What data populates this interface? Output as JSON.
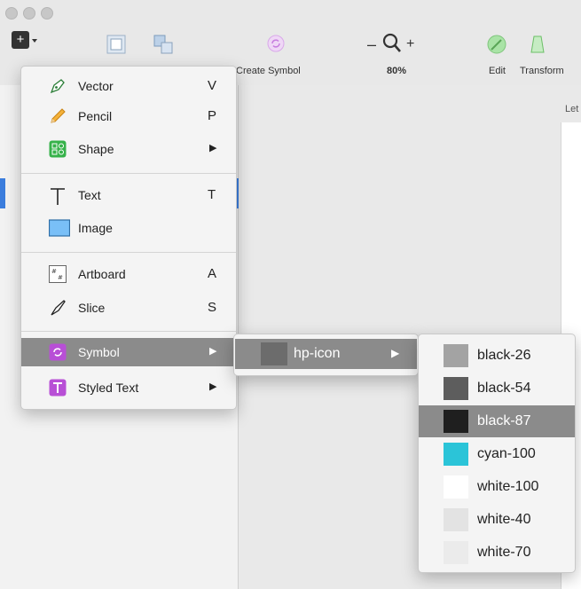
{
  "toolbar": {
    "insert_label": "+",
    "create_symbol_label": "Create Symbol",
    "zoom_minus": "–",
    "zoom_plus": "+",
    "zoom_level": "80%",
    "edit_label": "Edit",
    "transform_label": "Transform"
  },
  "canvas": {
    "artboard_label_partial": "Let"
  },
  "insert_menu": {
    "items": [
      {
        "label": "Vector",
        "shortcut": "V",
        "icon": "vector-pen-icon"
      },
      {
        "label": "Pencil",
        "shortcut": "P",
        "icon": "pencil-icon"
      },
      {
        "label": "Shape",
        "arrow": "▶",
        "icon": "shape-icon"
      },
      {
        "label": "Text",
        "shortcut": "T",
        "icon": "text-icon"
      },
      {
        "label": "Image",
        "icon": "image-icon"
      },
      {
        "label": "Artboard",
        "shortcut": "A",
        "icon": "artboard-icon"
      },
      {
        "label": "Slice",
        "shortcut": "S",
        "icon": "slice-knife-icon"
      },
      {
        "label": "Symbol",
        "arrow": "▶",
        "icon": "symbol-icon",
        "highlighted": true
      },
      {
        "label": "Styled Text",
        "arrow": "▶",
        "icon": "styled-text-icon"
      }
    ]
  },
  "symbol_submenu": {
    "label": "hp-icon",
    "arrow": "▶",
    "swatch_color": "#6c6c6c"
  },
  "color_submenu": {
    "items": [
      {
        "label": "black-26",
        "color": "#a3a3a3"
      },
      {
        "label": "black-54",
        "color": "#5d5d5d"
      },
      {
        "label": "black-87",
        "color": "#1f1f1f",
        "highlighted": true
      },
      {
        "label": "cyan-100",
        "color": "#2bc4d8"
      },
      {
        "label": "white-100",
        "color": "#ffffff"
      },
      {
        "label": "white-40",
        "color": "#e3e3e3"
      },
      {
        "label": "white-70",
        "color": "#ebebeb"
      }
    ]
  },
  "colors": {
    "accent_blue": "#3b7ddd",
    "highlight_gray": "#8b8b8b",
    "symbol_purple": "#b84fd6",
    "shape_green": "#36b24a"
  }
}
